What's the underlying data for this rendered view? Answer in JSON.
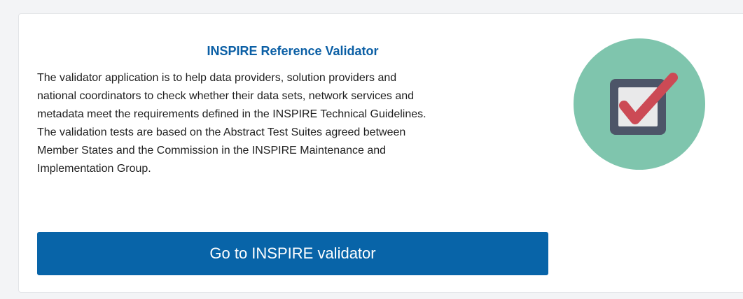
{
  "card": {
    "title": "INSPIRE Reference Validator",
    "description_lines": [
      "The validator application is to help data providers, solution providers and",
      "national coordinators to check whether their data sets, network services and",
      "metadata meet the requirements defined in the INSPIRE Technical Guidelines.",
      "The validation tests are based on the Abstract Test Suites agreed between",
      "Member States and the Commission in the INSPIRE Maintenance and",
      "Implementation Group."
    ],
    "button_label": "Go to INSPIRE validator",
    "icon": "checkbox-check-icon"
  },
  "colors": {
    "title": "#0b5fa5",
    "button": "#0864a8",
    "badge_circle": "#7fc5ad",
    "checkbox_frame": "#4d5568",
    "checkmark": "#cc4a55"
  }
}
